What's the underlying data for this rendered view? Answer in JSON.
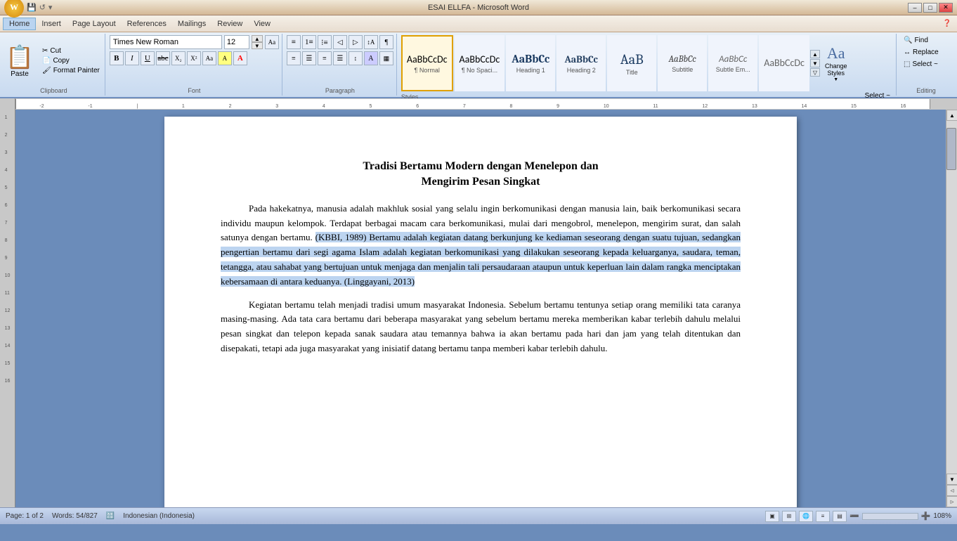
{
  "window": {
    "title": "ESAI ELLFA - Microsoft Word",
    "controls": [
      "minimize",
      "restore",
      "close"
    ]
  },
  "menu": {
    "items": [
      "Home",
      "Insert",
      "Page Layout",
      "References",
      "Mailings",
      "Review",
      "View"
    ]
  },
  "ribbon": {
    "clipboard": {
      "paste_label": "Paste",
      "cut_label": "Cut",
      "copy_label": "Copy",
      "format_painter_label": "Format Painter",
      "group_label": "Clipboard"
    },
    "font": {
      "name": "Times New Roman",
      "size": "12",
      "group_label": "Font"
    },
    "paragraph": {
      "group_label": "Paragraph"
    },
    "styles": {
      "items": [
        {
          "id": "normal",
          "preview": "AaBbCcDc",
          "label": "¶ Normal",
          "active": true
        },
        {
          "id": "no-spacing",
          "preview": "AaBbCcDc",
          "label": "¶ No Spaci..."
        },
        {
          "id": "heading1",
          "preview": "AaBbCc",
          "label": "Heading 1"
        },
        {
          "id": "heading2",
          "preview": "AaBbCc",
          "label": "Heading 2"
        },
        {
          "id": "title",
          "preview": "AaB",
          "label": "Title"
        },
        {
          "id": "subtitle",
          "preview": "AaBbCc",
          "label": "Subtitle"
        },
        {
          "id": "subtle-em",
          "preview": "AaBbCc",
          "label": "Subtle Em..."
        },
        {
          "id": "more",
          "preview": "AaBbCcDc",
          "label": ""
        }
      ],
      "group_label": "Styles",
      "change_styles_label": "Change\nStyles",
      "select_label": "Select ~"
    },
    "editing": {
      "find_label": "Find",
      "replace_label": "Replace",
      "select_label": "Select ~",
      "group_label": "Editing"
    }
  },
  "document": {
    "title_line1": "Tradisi Bertamu Modern dengan Menelepon dan",
    "title_line2": "Mengirim Pesan Singkat",
    "paragraph1_before": "Pada hakekatnya, manusia adalah makhluk sosial yang selalu ingin berkomunikasi dengan manusia lain, baik berkomunikasi secara individu maupun kelompok. Terdapat berbagai macam cara berkomunikasi, mulai dari mengobrol, menelepon, mengirim surat, dan salah satunya dengan bertamu.",
    "paragraph1_selected": "(KBBI, 1989) Bertamu adalah kegiatan datang berkunjung ke kediaman seseorang dengan suatu tujuan, sedangkan pengertian bertamu dari segi agama Islam adalah kegiatan berkomunikasi yang dilakukan seseorang kepada keluarganya, saudara, teman, tetangga, atau sahabat yang bertujuan untuk menjaga dan menjalin tali persaudaraan ataupun untuk keperluan lain dalam rangka menciptakan kebersamaan di antara keduanya. (Linggayani, 2013)",
    "paragraph2": "Kegiatan bertamu telah menjadi tradisi umum masyarakat Indonesia. Sebelum bertamu tentunya setiap orang memiliki tata caranya masing-masing. Ada tata cara bertamu dari beberapa masyarakat yang sebelum bertamu mereka memberikan kabar terlebih dahulu melalui pesan singkat dan telepon kepada sanak saudara atau temannya bahwa ia akan bertamu pada hari dan jam yang telah ditentukan dan disepakati, tetapi ada juga masyarakat yang inisiatif datang bertamu tanpa memberi kabar terlebih dahulu."
  },
  "status": {
    "page": "Page: 1 of 2",
    "words": "Words: 54/827",
    "language": "Indonesian (Indonesia)",
    "zoom": "108%"
  }
}
